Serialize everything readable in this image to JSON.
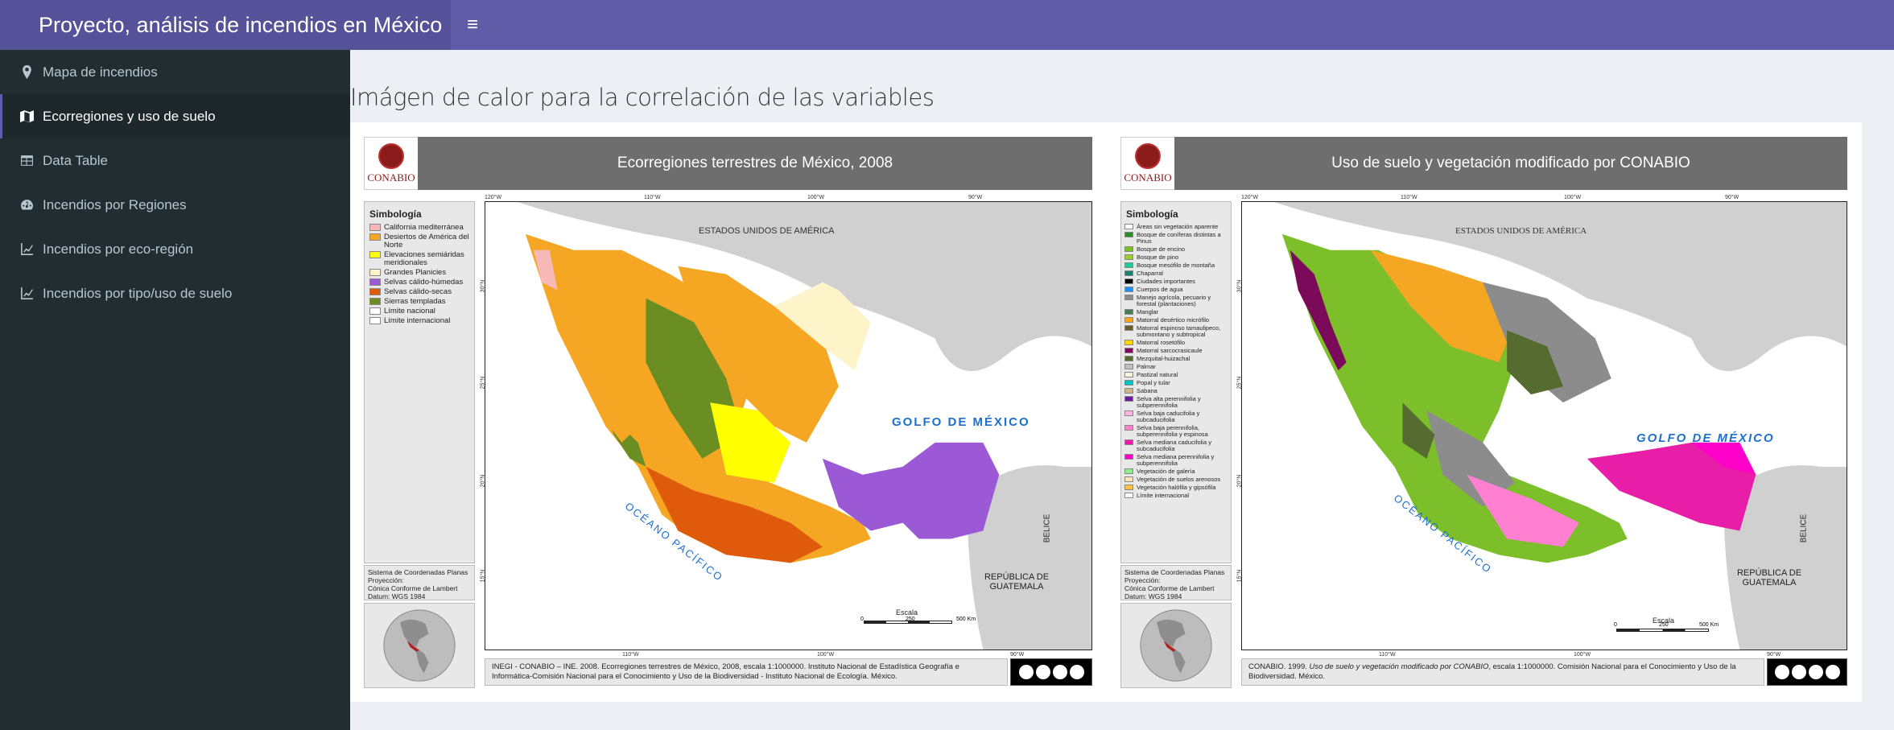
{
  "header": {
    "title": "Proyecto, análisis de incendios en México",
    "toggle_icon": "hamburger-icon",
    "toggle_glyph": "≡"
  },
  "sidebar": {
    "items": [
      {
        "label": "Mapa de incendios",
        "icon": "map-marker-icon"
      },
      {
        "label": "Ecorregiones y uso de suelo",
        "icon": "map-icon",
        "active": true
      },
      {
        "label": "Data Table",
        "icon": "table-icon"
      },
      {
        "label": "Incendios por Regiones",
        "icon": "dashboard-icon"
      },
      {
        "label": "Incendios por eco-región",
        "icon": "line-chart-icon"
      },
      {
        "label": "Incendios por tipo/uso de suelo",
        "icon": "line-chart-icon"
      }
    ]
  },
  "main": {
    "title": "Imágen de calor para la correlación de las variables"
  },
  "maps": {
    "left": {
      "title": "Ecorregiones terrestres de México, 2008",
      "logo_text": "CONABIO",
      "legend_title": "Simbología",
      "legend": [
        {
          "label": "California mediterránea",
          "color": "#f7b8b8"
        },
        {
          "label": "Desiertos de América del Norte",
          "color": "#f5a623"
        },
        {
          "label": "Elevaciones semiáridas meridionales",
          "color": "#ffff00"
        },
        {
          "label": "Grandes Planicies",
          "color": "#fdf5c9"
        },
        {
          "label": "Selvas cálido-húmedas",
          "color": "#9b59d6"
        },
        {
          "label": "Selvas cálido-secas",
          "color": "#e05a0c"
        },
        {
          "label": "Sierras templadas",
          "color": "#6b8e23"
        },
        {
          "label": "Límite nacional",
          "color": "#ffffff"
        },
        {
          "label": "Límite internacional",
          "color": "#ffffff"
        }
      ],
      "coords": [
        "Sistema de Coordenadas Planas",
        "Proyección:",
        "Cónica Conforme de Lambert",
        "Datum: WGS 1984"
      ],
      "labels": {
        "usa": "ESTADOS UNIDOS DE AMÉRICA",
        "gulf": "GOLFO DE MÉXICO",
        "ocean": "OCÉANO PACÍFICO",
        "guatemala": "REPÚBLICA DE GUATEMALA",
        "belize": "BELICE",
        "scale": "Escala",
        "scale_km": "500 Km",
        "scale_mid": "250",
        "scale_zero": "0"
      },
      "ticks_top": [
        "120°W",
        "110°W",
        "100°W",
        "90°W"
      ],
      "ticks_bottom": [
        "110°W",
        "100°W",
        "90°W"
      ],
      "ticks_side": [
        "30°N",
        "25°N",
        "20°N",
        "15°N"
      ],
      "source": "INEGI - CONABIO – INE. 2008. Ecorregiones terrestres de México, 2008, escala 1:1000000. Instituto Nacional de Estadística Geografía e Informática-Comisión Nacional para el Conocimiento y Uso de la Biodiversidad - Instituto Nacional de Ecología. México.",
      "cc": [
        "BY",
        "NC",
        "SA"
      ]
    },
    "right": {
      "title": "Uso de suelo y vegetación modificado por CONABIO",
      "logo_text": "CONABIO",
      "legend_title": "Simbología",
      "legend": [
        {
          "label": "Áreas sin vegetación aparente",
          "color": "#ffffff"
        },
        {
          "label": "Bosque de coníferas distintas a Pinus",
          "color": "#2e8b2e"
        },
        {
          "label": "Bosque de encino",
          "color": "#7cbf2a"
        },
        {
          "label": "Bosque de pino",
          "color": "#9acd32"
        },
        {
          "label": "Bosque mesófilo de montaña",
          "color": "#20c997"
        },
        {
          "label": "Chaparral",
          "color": "#1a7f6b"
        },
        {
          "label": "Ciudades importantes",
          "color": "#000000"
        },
        {
          "label": "Cuerpos de agua",
          "color": "#1e90ff"
        },
        {
          "label": "Manejo agrícola, pecuario y forestal (plantaciones)",
          "color": "#8c8c8c"
        },
        {
          "label": "Manglar",
          "color": "#4a7c59"
        },
        {
          "label": "Matorral desértico micrófilo",
          "color": "#f5a623"
        },
        {
          "label": "Matorral espinoso tamaulipeco, submontano y subtropical",
          "color": "#6b5a2a"
        },
        {
          "label": "Matorral rosetófilo",
          "color": "#ffd700"
        },
        {
          "label": "Matorral sarcocrasicaule",
          "color": "#7b0a5a"
        },
        {
          "label": "Mezquital-huizachal",
          "color": "#556b2f"
        },
        {
          "label": "Palmar",
          "color": "#c0c0c0"
        },
        {
          "label": "Pastizal natural",
          "color": "#f5f5dc"
        },
        {
          "label": "Popal y tular",
          "color": "#00bfbf"
        },
        {
          "label": "Sabana",
          "color": "#d2b48c"
        },
        {
          "label": "Selva alta perennifolia y subperennifolia",
          "color": "#6a1b9a"
        },
        {
          "label": "Selva baja caducifolia y subcaducifolia",
          "color": "#ffb6e6"
        },
        {
          "label": "Selva baja perennifolia, subperennifolia y espinosa",
          "color": "#ff80d0"
        },
        {
          "label": "Selva mediana caducifolia y subcaducifolia",
          "color": "#e91ea8"
        },
        {
          "label": "Selva mediana perennifolia y subperennifolia",
          "color": "#ff00c8"
        },
        {
          "label": "Vegetación de galería",
          "color": "#90ee90"
        },
        {
          "label": "Vegetación de suelos arenosos",
          "color": "#ffe4b5"
        },
        {
          "label": "Vegetación halófila y gipsófila",
          "color": "#ffc04d"
        },
        {
          "label": "Límite internacional",
          "color": "#ffffff"
        }
      ],
      "coords": [
        "Sistema de Coordenadas Planas",
        "Proyección:",
        "Cónica Conforme de Lambert",
        "Datum: WGS 1984"
      ],
      "labels": {
        "usa": "ESTADOS UNIDOS DE AMÉRICA",
        "gulf": "GOLFO DE MÉXICO",
        "ocean": "OCÉANO PACÍFICO",
        "guatemala": "REPÚBLICA DE GUATEMALA",
        "belize": "BELICE",
        "scale": "Escala",
        "scale_km": "500 Km",
        "scale_mid": "250",
        "scale_zero": "0"
      },
      "ticks_top": [
        "120°W",
        "110°W",
        "100°W",
        "90°W"
      ],
      "ticks_bottom": [
        "110°W",
        "100°W",
        "90°W"
      ],
      "ticks_side": [
        "30°N",
        "25°N",
        "20°N",
        "15°N"
      ],
      "source_prefix": "CONABIO. 1999.",
      "source_italic": "Uso de suelo y vegetación modificado por CONABIO",
      "source_suffix": ", escala 1:1000000. Comisión Nacional para el Conocimiento y Uso de la Biodiversidad. México.",
      "cc": [
        "BY",
        "NC",
        "SA"
      ]
    }
  }
}
